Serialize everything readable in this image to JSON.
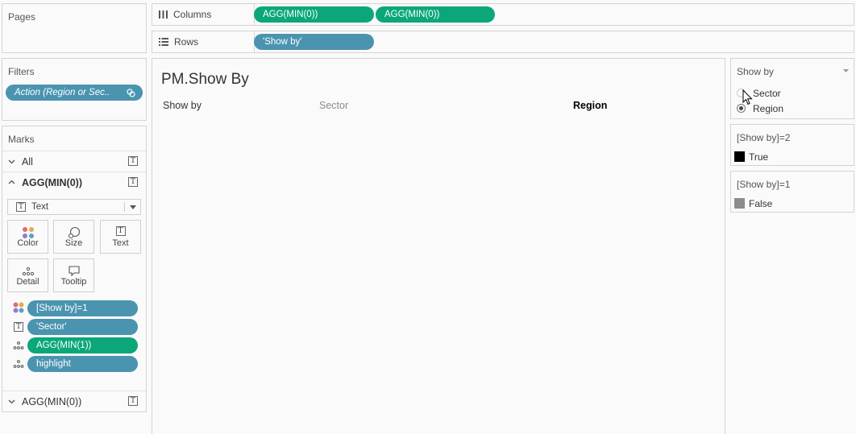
{
  "pages": {
    "title": "Pages"
  },
  "columns_shelf": {
    "label": "Columns",
    "pills": [
      "AGG(MIN(0))",
      "AGG(MIN(0))"
    ]
  },
  "rows_shelf": {
    "label": "Rows",
    "pills": [
      "'Show by'"
    ]
  },
  "filters": {
    "title": "Filters",
    "pill": "Action (Region or Sec.."
  },
  "marks": {
    "title": "Marks",
    "all_label": "All",
    "agg_label": "AGG(MIN(0))",
    "mark_type": "Text",
    "buttons": {
      "color": "Color",
      "size": "Size",
      "text": "Text",
      "detail": "Detail",
      "tooltip": "Tooltip"
    },
    "fields": [
      "[Show by]=1",
      "'Sector'",
      "AGG(MIN(1))",
      "highlight"
    ],
    "collapsed_label": "AGG(MIN(0))"
  },
  "view": {
    "title": "PM.Show By",
    "header_label": "Show by",
    "col_sector": "Sector",
    "col_region": "Region"
  },
  "parameter": {
    "title": "Show by",
    "options": [
      "Sector",
      "Region"
    ],
    "selected": "Region"
  },
  "legend_true": {
    "title": "[Show by]=2",
    "item": "True",
    "color": "#000000"
  },
  "legend_false": {
    "title": "[Show by]=1",
    "item": "False",
    "color": "#8c8c8c"
  },
  "colors": {
    "green_pill": "#0ba77a",
    "blue_pill": "#4a94b0"
  }
}
